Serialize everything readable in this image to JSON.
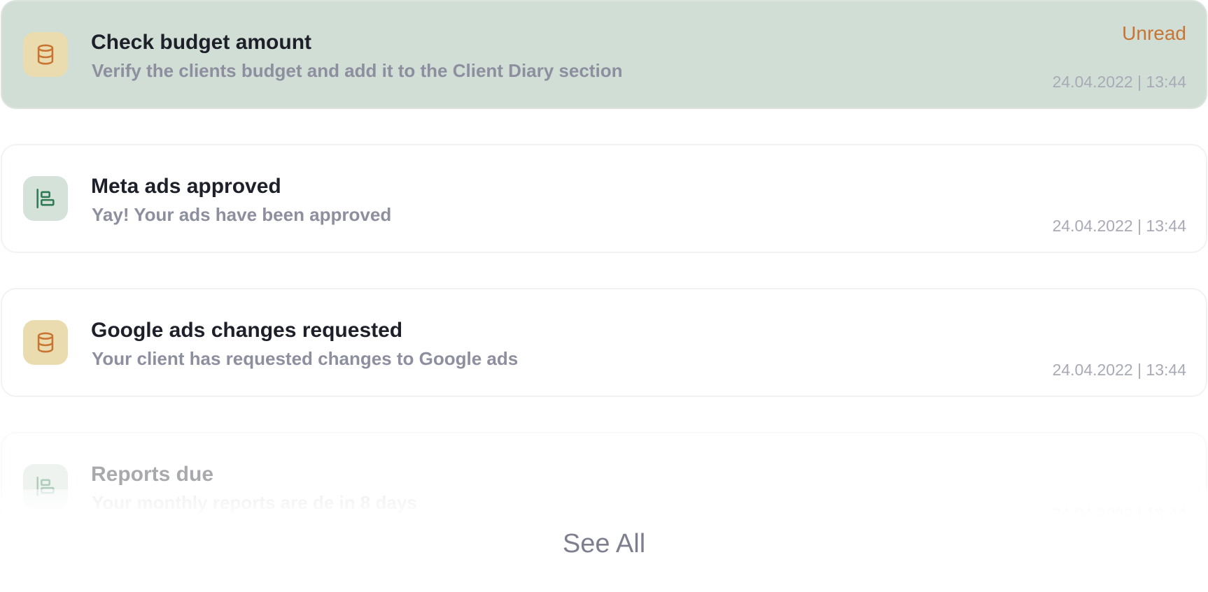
{
  "notifications": [
    {
      "title": "Check budget amount",
      "subtitle": "Verify the clients budget and add it to the Client Diary section",
      "status": "Unread",
      "timestamp": "24.04.2022 | 13:44",
      "icon": "database-icon"
    },
    {
      "title": "Meta ads approved",
      "subtitle": "Yay! Your ads have been approved",
      "timestamp": "24.04.2022 | 13:44",
      "icon": "align-left-icon"
    },
    {
      "title": "Google ads changes requested",
      "subtitle": "Your client has requested changes to Google ads",
      "timestamp": "24.04.2022 | 13:44",
      "icon": "database-icon"
    },
    {
      "title": "Reports due",
      "subtitle": "Your monthly reports are de in 8 days",
      "timestamp": "24.04.2022 | 13:44",
      "icon": "align-left-icon"
    }
  ],
  "footer": {
    "see_all_label": "See All"
  },
  "colors": {
    "unread_background": "#d1ded6",
    "unread_status": "#c87432",
    "orange_icon_bg": "#eadcae",
    "orange_icon_fg": "#c87432",
    "green_icon_bg": "#d4e2da",
    "green_icon_fg": "#2f7a52"
  }
}
